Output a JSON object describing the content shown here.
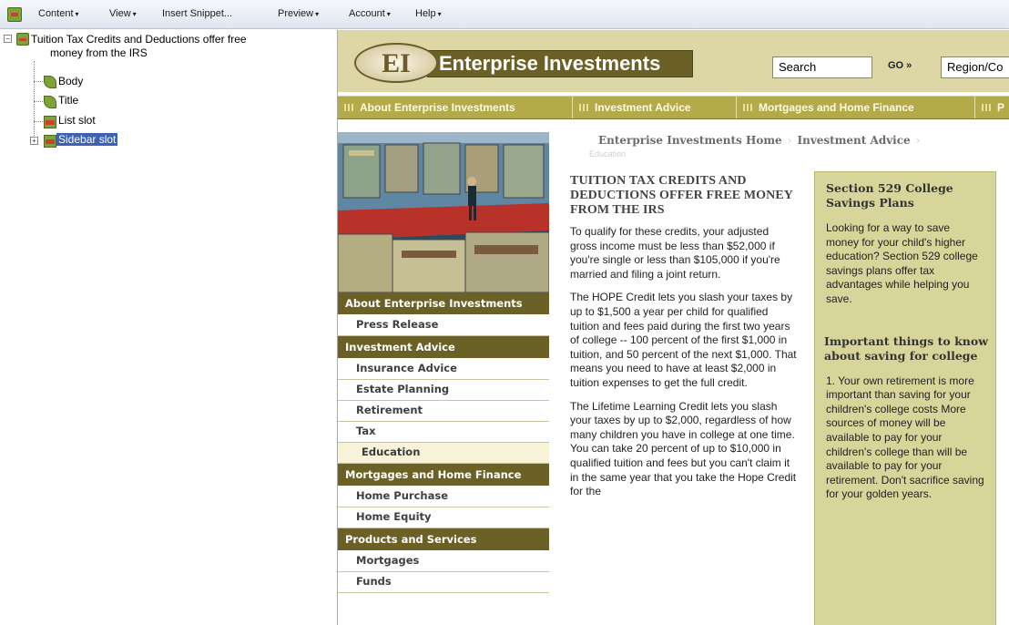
{
  "menubar": {
    "items": [
      "Content",
      "View",
      "Insert Snippet...",
      "Preview",
      "Account",
      "Help"
    ]
  },
  "tree": {
    "root": {
      "title_line1": "Tuition Tax Credits and Deductions offer free",
      "title_line2": "money from the IRS"
    },
    "children": [
      "Body",
      "Title",
      "List slot",
      "Sidebar slot"
    ]
  },
  "site": {
    "logo_text": "EI",
    "brand": "Enterprise Investments",
    "search_placeholder": "Search",
    "go_label": "GO »",
    "region_label": "Region/Co",
    "nav_tabs": [
      "About Enterprise Investments",
      "Investment Advice",
      "Mortgages and Home Finance",
      "P"
    ],
    "breadcrumb": [
      "Enterprise Investments Home",
      "Investment Advice"
    ],
    "breadcrumb_current": "Education",
    "sidenav": {
      "about_header": "About Enterprise Investments",
      "about_items": [
        "Press Release"
      ],
      "advice_header": "Investment Advice",
      "advice_items": [
        "Insurance Advice",
        "Estate Planning",
        "Retirement",
        "Tax"
      ],
      "advice_current": "Education",
      "mortgage_header": "Mortgages and Home Finance",
      "mortgage_items": [
        "Home Purchase",
        "Home Equity"
      ],
      "products_header": "Products and Services",
      "products_items": [
        "Mortgages",
        "Funds"
      ]
    },
    "article": {
      "title": "TUITION TAX CREDITS AND DEDUCTIONS OFFER FREE MONEY FROM THE IRS",
      "p1": "To qualify for these credits, your adjusted gross income must be less than $52,000 if you're single or less than $105,000 if you're married and filing a joint return.",
      "p2": "The HOPE Credit lets you slash your taxes by up to $1,500 a year per child for qualified tuition and fees paid during the first two years of college -- 100 percent of the first $1,000 in tuition, and 50 percent of the next $1,000. That means you need to have at least $2,000 in tuition expenses to get the full credit.",
      "p3": "The Lifetime Learning Credit lets you slash your taxes by up to $2,000, regardless of how many children you have in college at one time. You can take 20 percent of up to $10,000 in qualified tuition and fees but you can't claim it in the same year that you take the Hope Credit for the"
    },
    "sidebar": {
      "h1": "Section 529 College Savings Plans",
      "p1": "Looking for a way to save money for your child's higher education? Section 529 college savings plans offer tax advantages while helping you save.",
      "h2": "Important things to know about saving for college",
      "p2": "1. Your own retirement is more important than saving for your children's college costs More sources of money will be available to pay for your children's college than will be available to pay for your retirement. Don't sacrifice saving for your golden years."
    }
  }
}
